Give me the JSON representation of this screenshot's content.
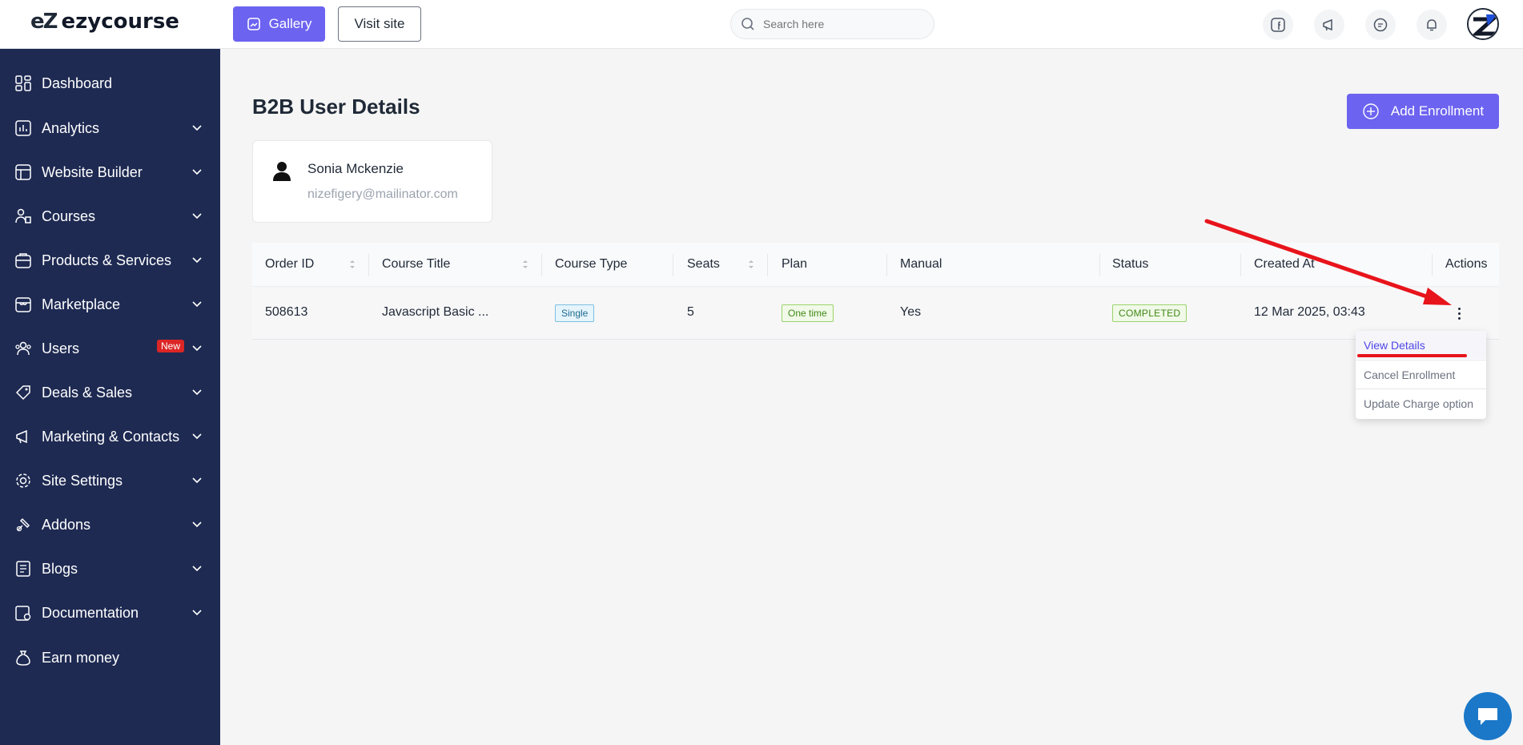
{
  "app": {
    "logo_mark": "eZ",
    "logo_text": "ezycourse"
  },
  "topbar": {
    "gallery_label": "Gallery",
    "visit_label": "Visit site",
    "search_placeholder": "Search here"
  },
  "sidebar": {
    "items": [
      {
        "label": "Dashboard",
        "icon": "dashboard-icon",
        "expandable": false
      },
      {
        "label": "Analytics",
        "icon": "analytics-icon",
        "expandable": true
      },
      {
        "label": "Website Builder",
        "icon": "website-builder-icon",
        "expandable": true
      },
      {
        "label": "Courses",
        "icon": "courses-icon",
        "expandable": true
      },
      {
        "label": "Products & Services",
        "icon": "products-icon",
        "expandable": true
      },
      {
        "label": "Marketplace",
        "icon": "marketplace-icon",
        "expandable": true
      },
      {
        "label": "Users",
        "icon": "users-icon",
        "expandable": true,
        "badge": "New"
      },
      {
        "label": "Deals & Sales",
        "icon": "deals-icon",
        "expandable": true
      },
      {
        "label": "Marketing & Contacts",
        "icon": "marketing-icon",
        "expandable": true
      },
      {
        "label": "Site Settings",
        "icon": "settings-icon",
        "expandable": true
      },
      {
        "label": "Addons",
        "icon": "addons-icon",
        "expandable": true
      },
      {
        "label": "Blogs",
        "icon": "blogs-icon",
        "expandable": true
      },
      {
        "label": "Documentation",
        "icon": "documentation-icon",
        "expandable": true
      },
      {
        "label": "Earn money",
        "icon": "earn-money-icon",
        "expandable": false
      }
    ]
  },
  "main": {
    "title": "B2B User Details",
    "add_button": "Add Enrollment",
    "user": {
      "name": "Sonia Mckenzie",
      "email": "nizefigery@mailinator.com"
    },
    "table": {
      "columns": [
        "Order ID",
        "Course Title",
        "Course Type",
        "Seats",
        "Plan",
        "Manual",
        "Status",
        "Created At",
        "Actions"
      ],
      "rows": [
        {
          "order_id": "508613",
          "course_title": "Javascript Basic ...",
          "course_type": "Single",
          "seats": "5",
          "plan": "One time",
          "manual": "Yes",
          "status": "COMPLETED",
          "created_at": "12 Mar 2025, 03:43"
        }
      ]
    },
    "actions_menu": [
      "View Details",
      "Cancel Enrollment",
      "Update Charge option"
    ]
  },
  "colors": {
    "sidebar_bg": "#1e2a52",
    "primary": "#6c63f0",
    "annotation": "#e8141b"
  }
}
